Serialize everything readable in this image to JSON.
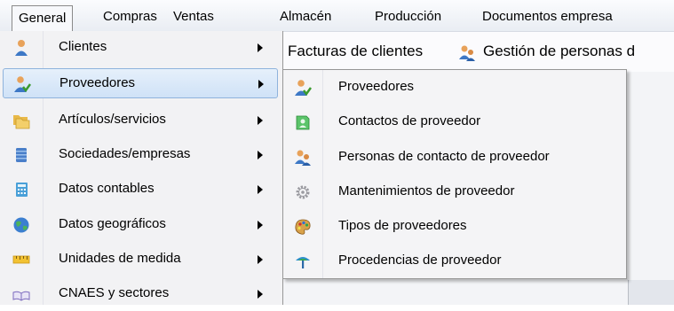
{
  "menubar": {
    "items": [
      "General",
      "Compras",
      "Ventas",
      "Almacén",
      "Producción",
      "Documentos empresa"
    ]
  },
  "toolbar": {
    "facturas_label": "Facturas de clientes",
    "gestion_label": "Gestión de personas d"
  },
  "dropdown": {
    "items": [
      {
        "label": "Clientes",
        "icon": "person-icon"
      },
      {
        "label": "Proveedores",
        "icon": "supplier-icon"
      },
      {
        "label": "Artículos/servicios",
        "icon": "folders-icon"
      },
      {
        "label": "Sociedades/empresas",
        "icon": "database-icon"
      },
      {
        "label": "Datos contables",
        "icon": "calculator-icon"
      },
      {
        "label": "Datos geográficos",
        "icon": "globe-icon"
      },
      {
        "label": "Unidades de medida",
        "icon": "ruler-icon"
      },
      {
        "label": "CNAES y sectores",
        "icon": "book-icon"
      }
    ]
  },
  "submenu": {
    "items": [
      {
        "label": "Proveedores",
        "icon": "supplier-icon"
      },
      {
        "label": "Contactos de proveedor",
        "icon": "contact-icon"
      },
      {
        "label": "Personas de contacto de proveedor",
        "icon": "contact-persons-icon"
      },
      {
        "label": "Mantenimientos de proveedor",
        "icon": "gear-icon"
      },
      {
        "label": "Tipos de proveedores",
        "icon": "palette-icon"
      },
      {
        "label": "Procedencias de proveedor",
        "icon": "tree-icon"
      }
    ]
  }
}
